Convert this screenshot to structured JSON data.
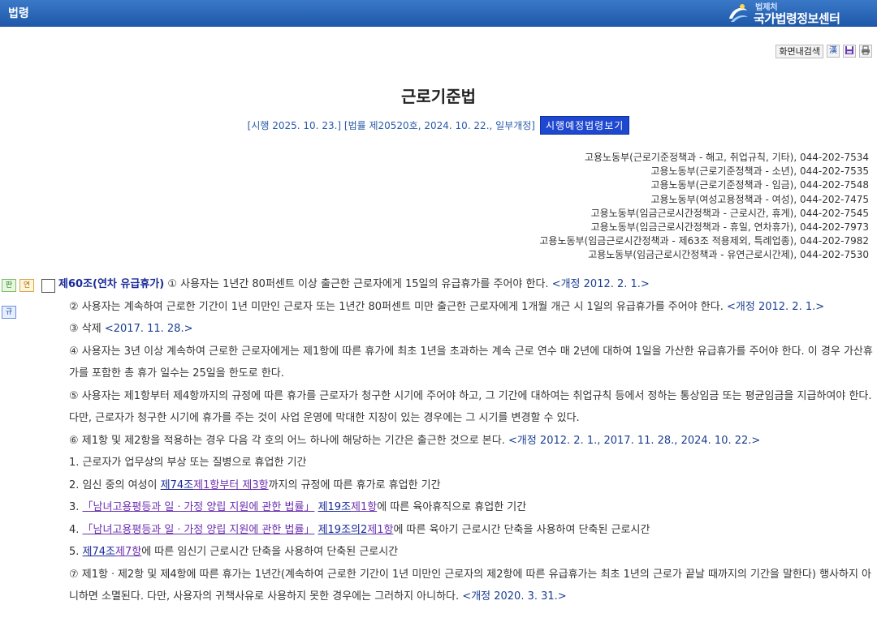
{
  "header": {
    "left_title": "법령",
    "brand_sub": "법제처",
    "brand_name": "국가법령정보센터"
  },
  "toolbar": {
    "search_label": "화면내검색",
    "hanja_icon_label": "漢"
  },
  "law": {
    "title": "근로기준법",
    "enforce_info": "[시행 2025. 10. 23.] [법률 제20520호, 2024. 10. 22., 일부개정]",
    "schedule_button": "시행예정법령보기"
  },
  "contacts": [
    "고용노동부(근로기준정책과 - 해고, 취업규칙, 기타), 044-202-7534",
    "고용노동부(근로기준정책과 - 소년), 044-202-7535",
    "고용노동부(근로기준정책과 - 임금), 044-202-7548",
    "고용노동부(여성고용정책과 - 여성), 044-202-7475",
    "고용노동부(임금근로시간정책과 - 근로시간, 휴게), 044-202-7545",
    "고용노동부(임금근로시간정책과 - 휴일, 연차휴가), 044-202-7973",
    "고용노동부(임금근로시간정책과 - 제63조 적용제외, 특례업종), 044-202-7982",
    "고용노동부(임금근로시간정책과 - 유연근로시간제), 044-202-7530"
  ],
  "tags": {
    "pan": "판",
    "yeon": "연",
    "gyu": "규"
  },
  "article": {
    "title": "제60조(연차 유급휴가)",
    "p1": "① 사용자는 1년간 80퍼센트 이상 출근한 근로자에게 15일의 유급휴가를 주어야 한다.",
    "p1_amend": "<개정 2012. 2. 1.>",
    "p2": "② 사용자는 계속하여 근로한 기간이 1년 미만인 근로자 또는 1년간 80퍼센트 미만 출근한 근로자에게 1개월 개근 시 1일의 유급휴가를 주어야 한다.",
    "p2_amend": "<개정 2012. 2. 1.>",
    "p3": "③ 삭제",
    "p3_amend": "<2017. 11. 28.>",
    "p4": "④ 사용자는 3년 이상 계속하여 근로한 근로자에게는 제1항에 따른 휴가에 최초 1년을 초과하는 계속 근로 연수 매 2년에 대하여 1일을 가산한 유급휴가를 주어야 한다. 이 경우 가산휴가를 포함한 총 휴가 일수는 25일을 한도로 한다.",
    "p5": "⑤ 사용자는 제1항부터 제4항까지의 규정에 따른 휴가를 근로자가 청구한 시기에 주어야 하고, 그 기간에 대하여는 취업규칙 등에서 정하는 통상임금 또는 평균임금을 지급하여야 한다. 다만, 근로자가 청구한 시기에 휴가를 주는 것이 사업 운영에 막대한 지장이 있는 경우에는 그 시기를 변경할 수 있다.",
    "p6": "⑥ 제1항 및 제2항을 적용하는 경우 다음 각 호의 어느 하나에 해당하는 기간은 출근한 것으로 본다.",
    "p6_amend": "<개정 2012. 2. 1., 2017. 11. 28., 2024. 10. 22.>",
    "items": {
      "i1": "1. 근로자가 업무상의 부상 또는 질병으로 휴업한 기간",
      "i2_pre": "2. 임신 중의 여성이 ",
      "i2_link1": "제74조",
      "i2_link2": "제1항부터 제3항",
      "i2_post": "까지의 규정에 따른 휴가로 휴업한 기간",
      "i3_pre": "3. ",
      "i3_law": "「남녀고용평등과 일ㆍ가정 양립 지원에 관한 법률」",
      "i3_link1": "제19조",
      "i3_link2": "제1항",
      "i3_post": "에 따른 육아휴직으로 휴업한 기간",
      "i4_pre": "4. ",
      "i4_law": "「남녀고용평등과 일ㆍ가정 양립 지원에 관한 법률」",
      "i4_link1": "제19조의2",
      "i4_link2": "제1항",
      "i4_post": "에 따른 육아기 근로시간 단축을 사용하여 단축된 근로시간",
      "i5_pre": "5. ",
      "i5_link1": "제74조",
      "i5_link2": "제7항",
      "i5_post": "에 따른 임신기 근로시간 단축을 사용하여 단축된 근로시간"
    },
    "p7": "⑦ 제1항ㆍ제2항 및 제4항에 따른 휴가는 1년간(계속하여 근로한 기간이 1년 미만인 근로자의 제2항에 따른 유급휴가는 최초 1년의 근로가 끝날 때까지의 기간을 말한다) 행사하지 아니하면 소멸된다. 다만, 사용자의 귀책사유로 사용하지 못한 경우에는 그러하지 아니하다.",
    "p7_amend": "<개정 2020. 3. 31.>"
  }
}
